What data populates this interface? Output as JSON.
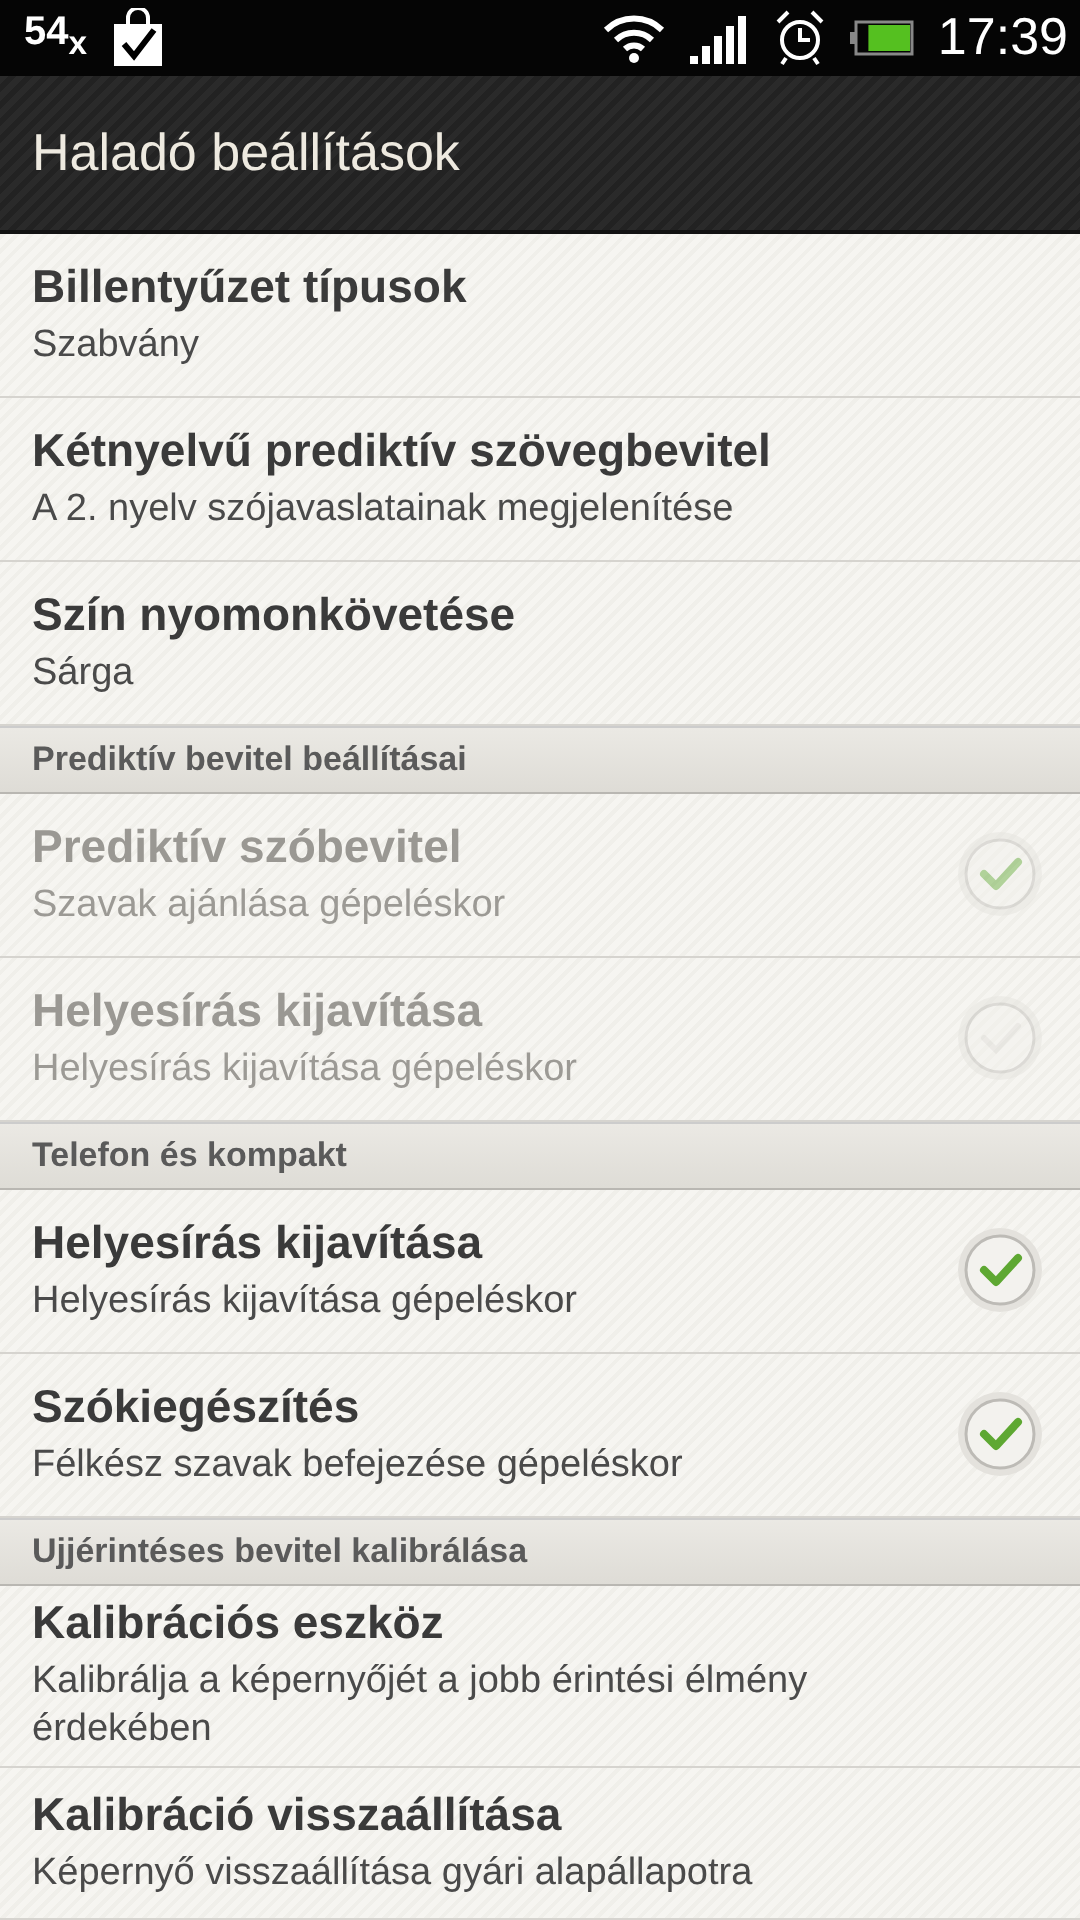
{
  "status_bar": {
    "notification": "54$_{x}$",
    "time": "17:39"
  },
  "action_bar": {
    "title": "Haladó beállítások"
  },
  "items": [
    {
      "kind": "item",
      "title": "Billentyűzet típusok",
      "summary": "Szabvány",
      "disabled": false
    },
    {
      "kind": "item",
      "title": "Kétnyelvű prediktív szövegbevitel",
      "summary": "A 2. nyelv szójavaslatainak megjelenítése",
      "disabled": false
    },
    {
      "kind": "item",
      "title": "Szín nyomonkövetése",
      "summary": "Sárga",
      "disabled": false
    },
    {
      "kind": "header",
      "title": "Prediktív bevitel beállításai"
    },
    {
      "kind": "check",
      "title": "Prediktív szóbevitel",
      "summary": "Szavak ajánlása gépeléskor",
      "disabled": true,
      "checked": true
    },
    {
      "kind": "check",
      "title": "Helyesírás kijavítása",
      "summary": "Helyesírás kijavítása gépeléskor",
      "disabled": true,
      "checked": false
    },
    {
      "kind": "header",
      "title": "Telefon és kompakt"
    },
    {
      "kind": "check",
      "title": "Helyesírás kijavítása",
      "summary": "Helyesírás kijavítása gépeléskor",
      "disabled": false,
      "checked": true
    },
    {
      "kind": "check",
      "title": "Szókiegészítés",
      "summary": "Félkész szavak befejezése gépeléskor",
      "disabled": false,
      "checked": true
    },
    {
      "kind": "header",
      "title": "Ujjérintéses bevitel kalibrálása"
    },
    {
      "kind": "item",
      "title": "Kalibrációs eszköz",
      "summary": "Kalibrálja a képernyőjét a jobb érintési élmény érdekében",
      "disabled": false
    },
    {
      "kind": "item",
      "title": "Kalibráció visszaállítása",
      "summary": "Képernyő visszaállítása gyári alapállapotra",
      "disabled": false
    }
  ]
}
